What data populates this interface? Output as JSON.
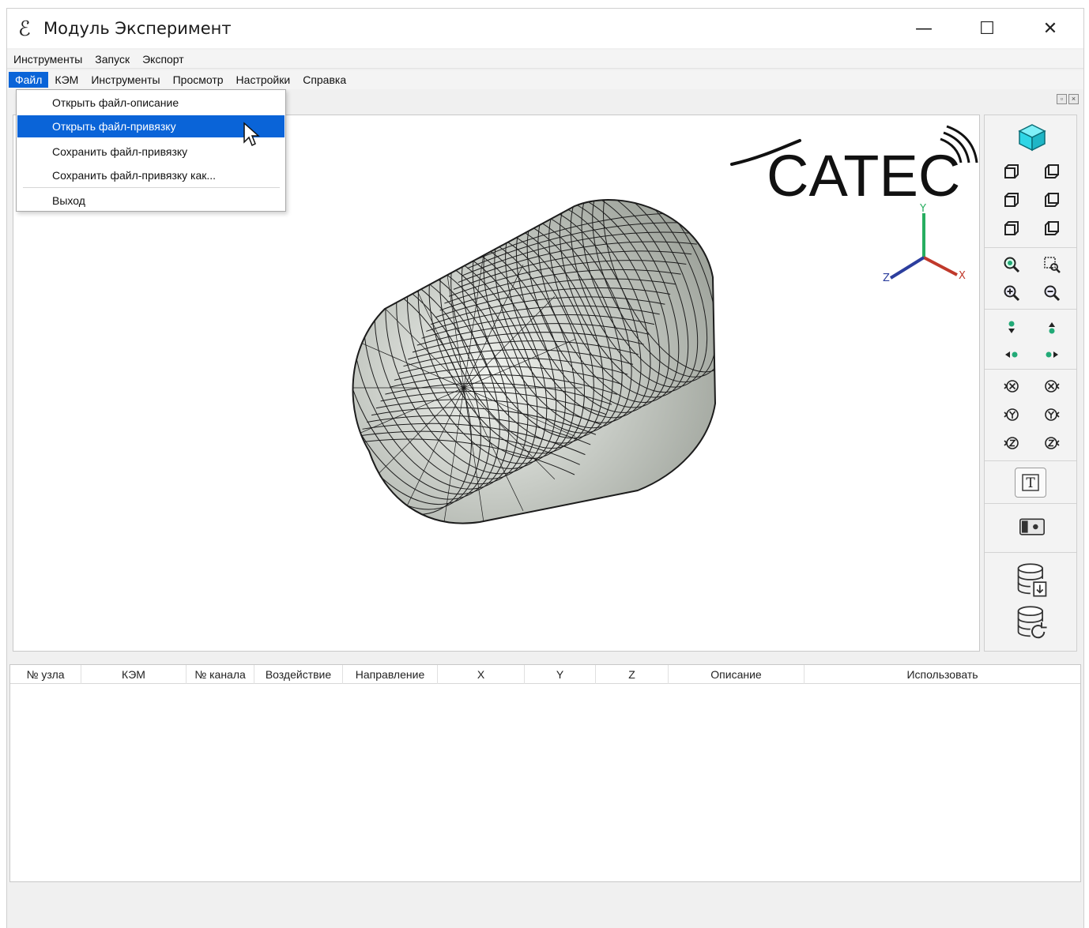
{
  "window": {
    "title": "Модуль Эксперимент",
    "app_icon": "app-logo-icon",
    "controls": {
      "minimize": "—",
      "maximize": "☐",
      "close": "✕"
    }
  },
  "menubar_top": {
    "items": [
      {
        "label": "Инструменты"
      },
      {
        "label": "Запуск"
      },
      {
        "label": "Экспорт"
      }
    ]
  },
  "menubar_main": {
    "items": [
      {
        "label": "Файл"
      },
      {
        "label": "КЭМ"
      },
      {
        "label": "Инструменты"
      },
      {
        "label": "Просмотр"
      },
      {
        "label": "Настройки"
      },
      {
        "label": "Справка"
      }
    ]
  },
  "file_menu": {
    "items": [
      {
        "label": "Открыть файл-описание"
      },
      {
        "label": "Открыть файл-привязку"
      },
      {
        "label": "Сохранить файл-привязку"
      },
      {
        "label": "Сохранить файл-привязку как..."
      },
      {
        "label": "Выход"
      }
    ],
    "selected_index": 1
  },
  "viewport": {
    "logo_text": "CATEC",
    "axes": {
      "x": "X",
      "y": "Y",
      "z": "Z"
    },
    "model_fill": "#c8ccc6",
    "mesh_stroke": "#1c1c1c"
  },
  "toolbar": {
    "groups": [
      {
        "name": "view-orientation",
        "icons": [
          "iso-cube-icon",
          "front-view-icon",
          "back-view-icon",
          "left-view-icon",
          "right-view-icon",
          "top-view-icon",
          "bottom-view-icon"
        ]
      },
      {
        "name": "zoom",
        "icons": [
          "zoom-fit-icon",
          "zoom-window-icon",
          "zoom-in-icon",
          "zoom-out-icon"
        ]
      },
      {
        "name": "pan",
        "icons": [
          "pan-down-icon",
          "pan-up-icon",
          "pan-left-icon",
          "pan-right-icon"
        ]
      },
      {
        "name": "rotate",
        "icons": [
          "rotate-x-neg-icon",
          "rotate-x-pos-icon",
          "rotate-y-neg-icon",
          "rotate-y-pos-icon",
          "rotate-z-neg-icon",
          "rotate-z-pos-icon"
        ]
      },
      {
        "name": "text",
        "icons": [
          "text-label-icon"
        ]
      },
      {
        "name": "snapshot",
        "icons": [
          "camera-icon"
        ]
      },
      {
        "name": "database",
        "icons": [
          "database-import-icon",
          "database-refresh-icon"
        ]
      }
    ],
    "text_icon_glyph": "T"
  },
  "table": {
    "columns": [
      {
        "label": "№ узла"
      },
      {
        "label": "КЭМ"
      },
      {
        "label": "№ канала"
      },
      {
        "label": "Воздействие"
      },
      {
        "label": "Направление"
      },
      {
        "label": "X"
      },
      {
        "label": "Y"
      },
      {
        "label": "Z"
      },
      {
        "label": "Описание"
      },
      {
        "label": "Использовать"
      }
    ],
    "rows": []
  },
  "colors": {
    "accent": "#0a64d8",
    "cube": "#2fd6e6",
    "axis_x": "#c0392b",
    "axis_y": "#27ae60",
    "axis_z": "#2c3e9e"
  }
}
